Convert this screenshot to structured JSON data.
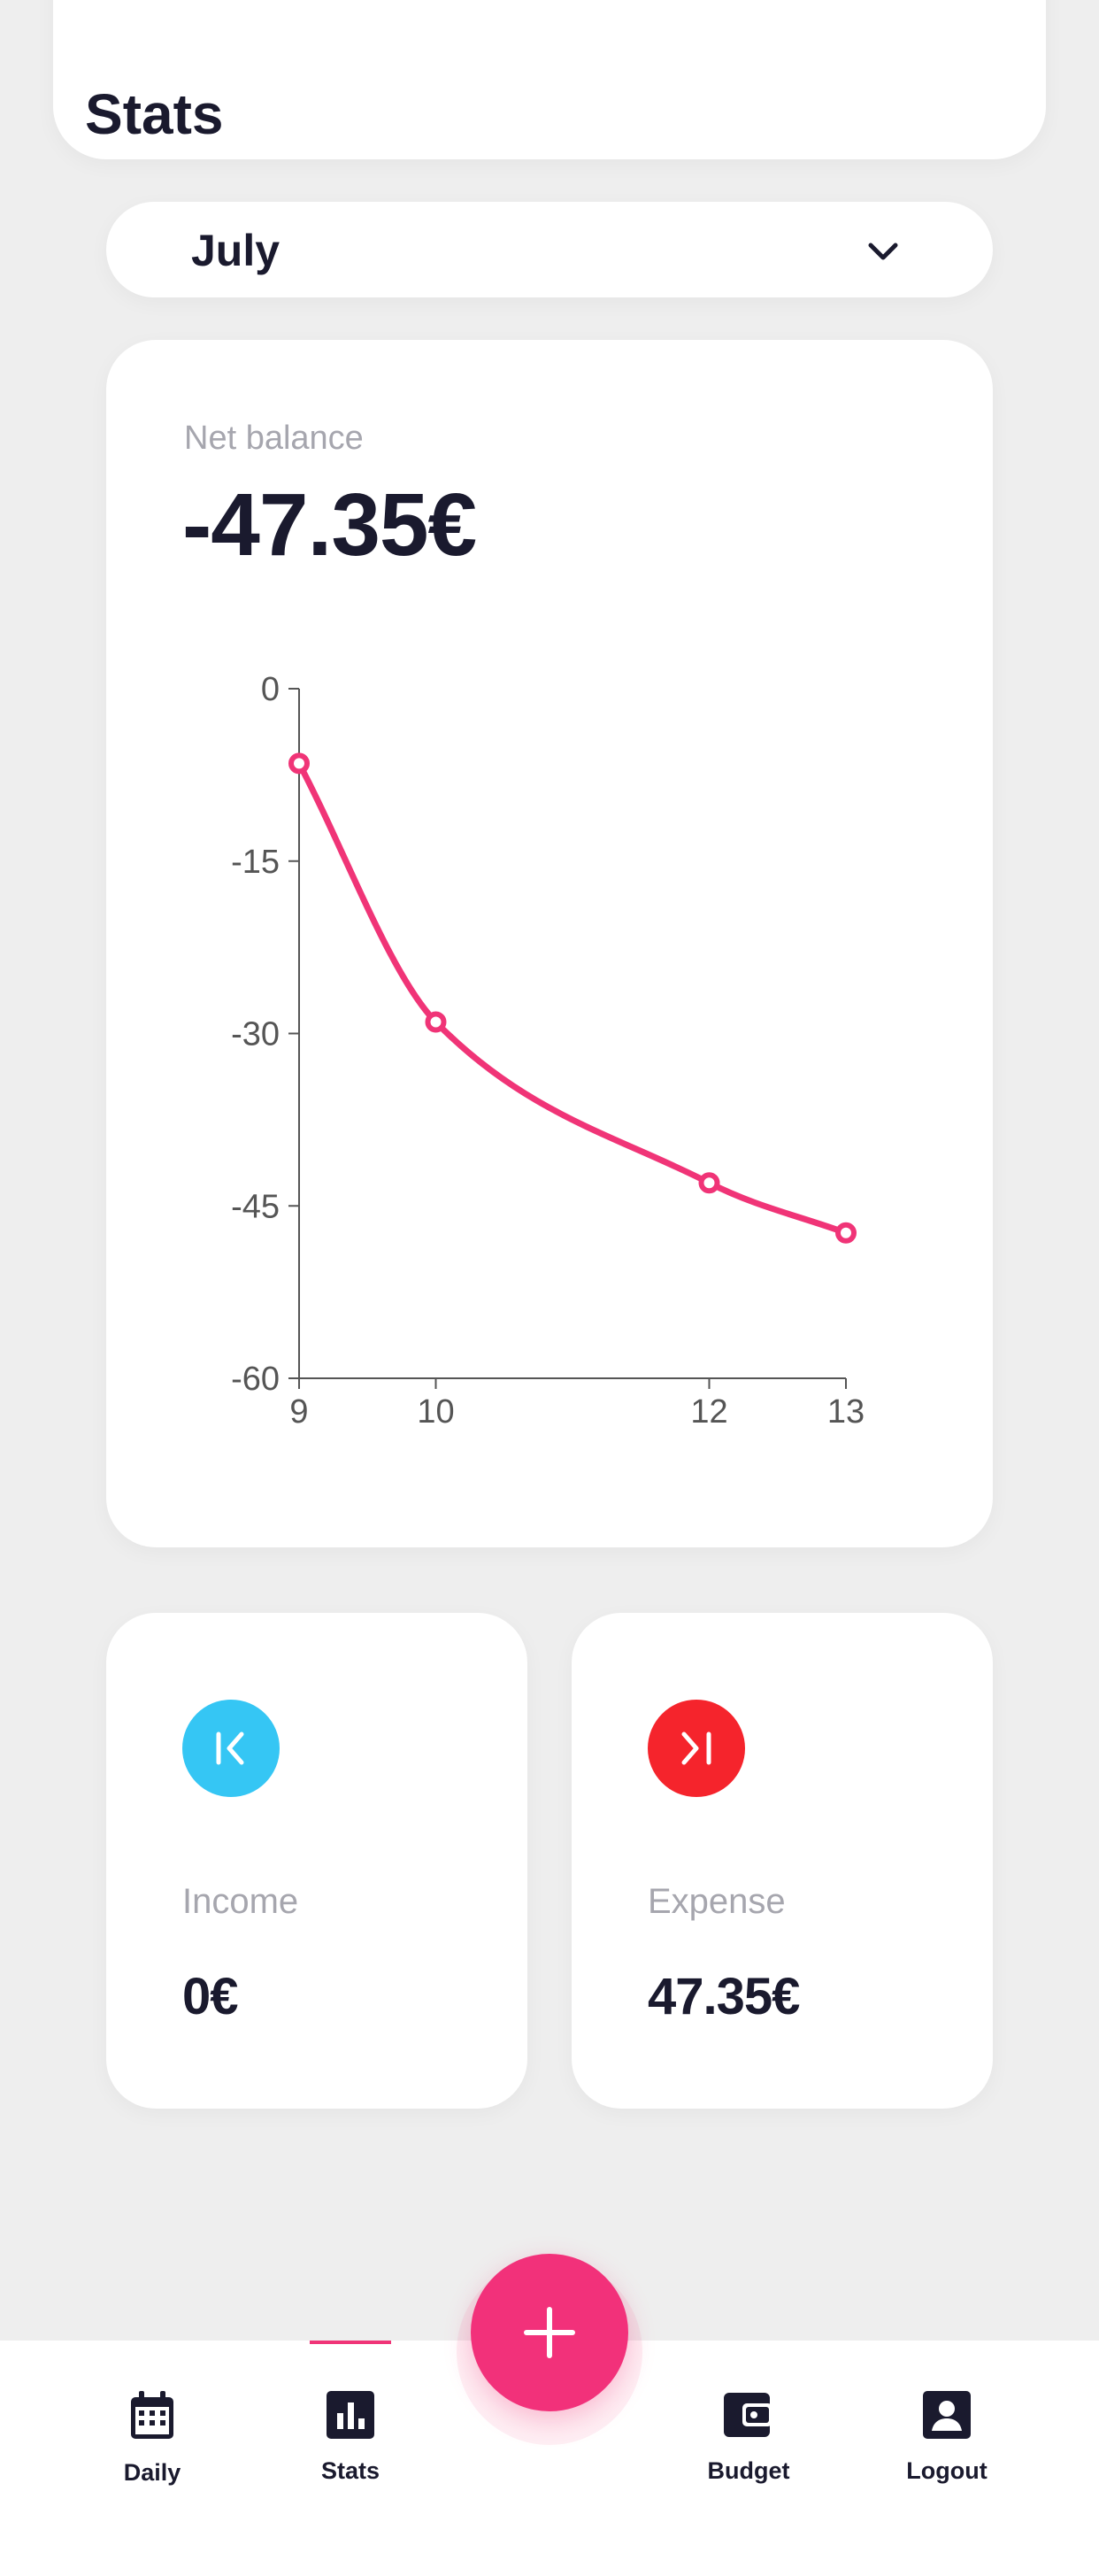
{
  "header": {
    "title": "Stats"
  },
  "month_selector": {
    "selected": "July",
    "icon": "chevron-down-icon"
  },
  "balance": {
    "label": "Net balance",
    "value": "-47.35€"
  },
  "chart_data": {
    "type": "line",
    "title": "",
    "xlabel": "",
    "ylabel": "",
    "x": [
      9,
      10,
      12,
      13
    ],
    "x_ticks": [
      "9",
      "10",
      "12",
      "13"
    ],
    "y_ticks": [
      "0",
      "-15",
      "-30",
      "-45",
      "-60"
    ],
    "ylim": [
      -60,
      0
    ],
    "series": [
      {
        "values": [
          -6.5,
          -29,
          -43,
          -47.35
        ],
        "color": "#f03477"
      }
    ],
    "smooth": true,
    "grid": false
  },
  "income": {
    "label": "Income",
    "value": "0€",
    "icon": "income-arrow-icon",
    "color": "#35c6f4"
  },
  "expense": {
    "label": "Expense",
    "value": "47.35€",
    "icon": "expense-arrow-icon",
    "color": "#f5242c"
  },
  "nav": {
    "items": [
      {
        "label": "Daily",
        "icon": "calendar-icon"
      },
      {
        "label": "Stats",
        "icon": "bar-chart-icon",
        "active": true
      },
      {
        "label": "Budget",
        "icon": "wallet-icon"
      },
      {
        "label": "Logout",
        "icon": "account-icon"
      }
    ],
    "fab_icon": "plus-icon"
  },
  "colors": {
    "accent": "#f03477",
    "text": "#1a1a2e",
    "muted": "#a6a6ae",
    "background": "#eeeeee"
  }
}
